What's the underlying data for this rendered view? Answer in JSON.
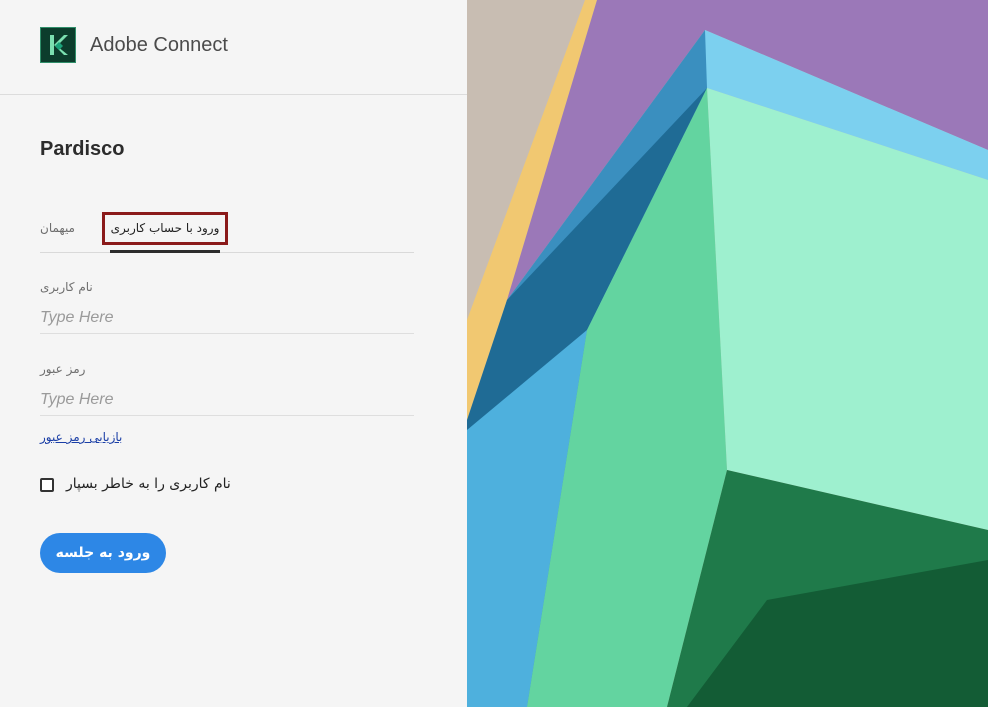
{
  "header": {
    "app_name": "Adobe Connect",
    "logo_icon": "adobe-connect-logo"
  },
  "main": {
    "org_name": "Pardisco",
    "tabs": [
      {
        "label": "میهمان",
        "selected": false
      },
      {
        "label": "ورود با حساب کاربری",
        "selected": true
      }
    ],
    "username": {
      "label": "نام کاربری",
      "placeholder": "Type Here",
      "value": ""
    },
    "password": {
      "label": "رمز عبور",
      "placeholder": "Type Here",
      "value": ""
    },
    "forgot_password_link": "بازیابی رمز عبور",
    "remember_me": {
      "label": "نام کاربری را به خاطر بسپار",
      "checked": false
    },
    "login_button": "ورود به جلسه"
  },
  "colors": {
    "accent": "#2d87e6",
    "highlight_border": "#8b1a1a",
    "link": "#1a3ea6"
  }
}
